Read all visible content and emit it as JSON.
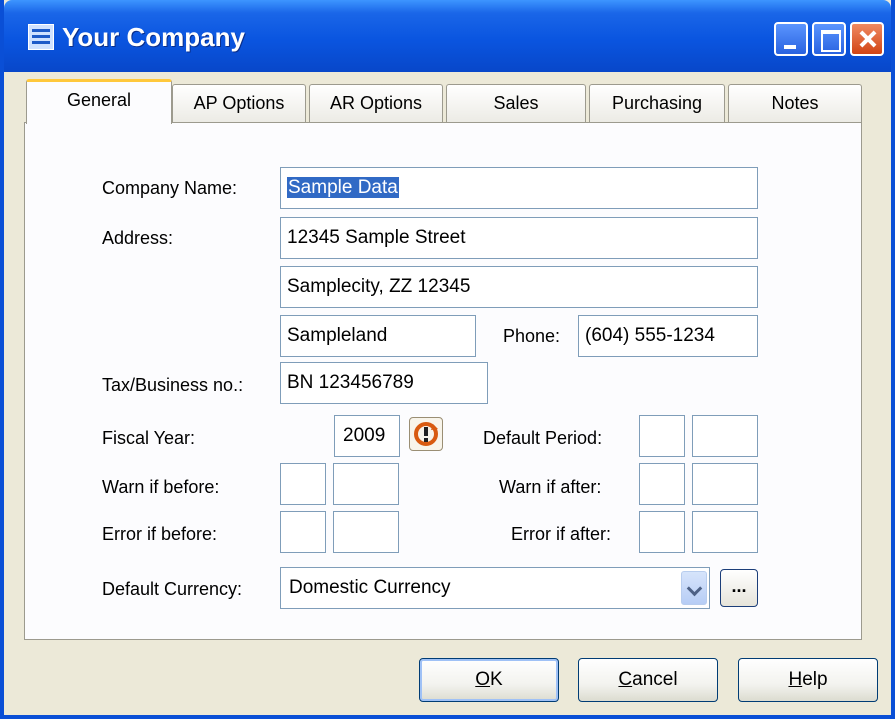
{
  "window": {
    "title": "Your Company"
  },
  "tabs": [
    {
      "label": "General",
      "active": true
    },
    {
      "label": "AP Options"
    },
    {
      "label": "AR Options"
    },
    {
      "label": "Sales"
    },
    {
      "label": "Purchasing"
    },
    {
      "label": "Notes"
    }
  ],
  "form": {
    "company_name_label": "Company Name:",
    "company_name": "Sample Data",
    "address_label": "Address:",
    "address_line1": "12345 Sample Street",
    "address_line2": "Samplecity, ZZ 12345",
    "address_line3": "Sampleland",
    "phone_label": "Phone:",
    "phone": "(604) 555-1234",
    "tax_label": "Tax/Business no.:",
    "tax": "BN 123456789",
    "fiscal_year_label": "Fiscal Year:",
    "fiscal_year": "2009",
    "default_period_label": "Default Period:",
    "warn_before_label": "Warn if before:",
    "warn_after_label": "Warn if after:",
    "error_before_label": "Error if before:",
    "error_after_label": "Error if after:",
    "default_currency_label": "Default Currency:",
    "default_currency": "Domestic Currency",
    "ellipsis": "..."
  },
  "buttons": {
    "ok_mnemonic": "O",
    "ok_rest": "K",
    "cancel_mnemonic": "C",
    "cancel_rest": "ancel",
    "help_mnemonic": "H",
    "help_rest": "elp"
  },
  "colors": {
    "titlebar": "#0a55e0",
    "selection": "#316ac5",
    "active_tab_accent": "#ffc83c"
  }
}
